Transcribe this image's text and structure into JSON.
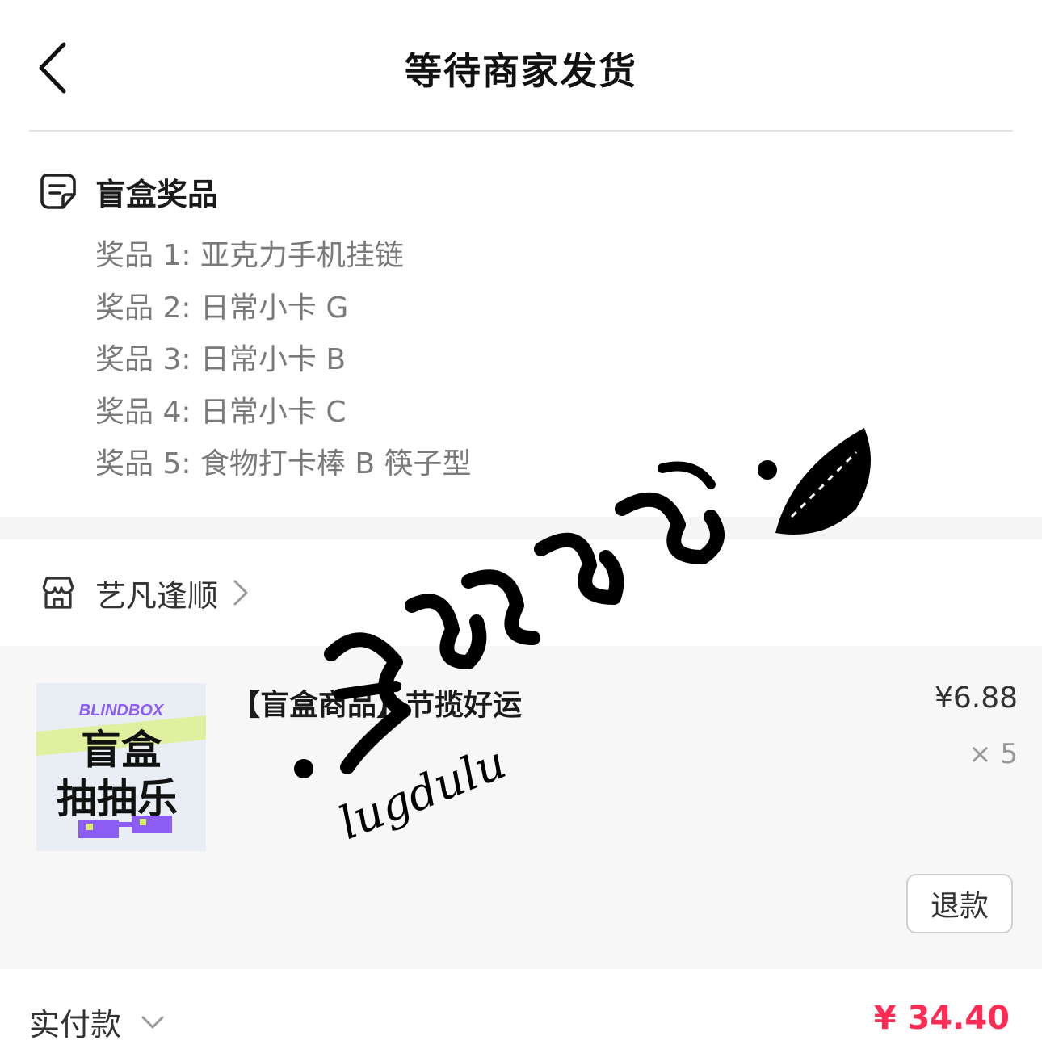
{
  "header": {
    "title": "等待商家发货"
  },
  "prizes": {
    "heading": "盲盒奖品",
    "items": [
      "奖品 1: 亚克力手机挂链",
      "奖品 2: 日常小卡 G",
      "奖品 3: 日常小卡 B",
      "奖品 4: 日常小卡 C",
      "奖品 5: 食物打卡棒 B 筷子型"
    ]
  },
  "shop": {
    "name": "艺凡逢顺"
  },
  "product": {
    "name": "【盲盒商品】节揽好运",
    "price": "¥6.88",
    "quantity": "× 5",
    "thumb": {
      "brand": "BLINDBOX",
      "line1": "盲盒",
      "line2": "抽抽乐"
    },
    "refund_label": "退款"
  },
  "total": {
    "label": "实付款",
    "amount": "¥ 34.40"
  },
  "watermark": {
    "text": "lugdulu"
  },
  "colors": {
    "accent": "#fe2c55",
    "muted": "#7a7a7a",
    "band": "#f5f5f5",
    "card": "#f7f7f7"
  },
  "icons": {
    "back": "chevron-left-icon",
    "prize": "note-icon",
    "shop": "store-icon",
    "shop_arrow": "chevron-right-icon",
    "total_arrow": "chevron-down-icon"
  }
}
